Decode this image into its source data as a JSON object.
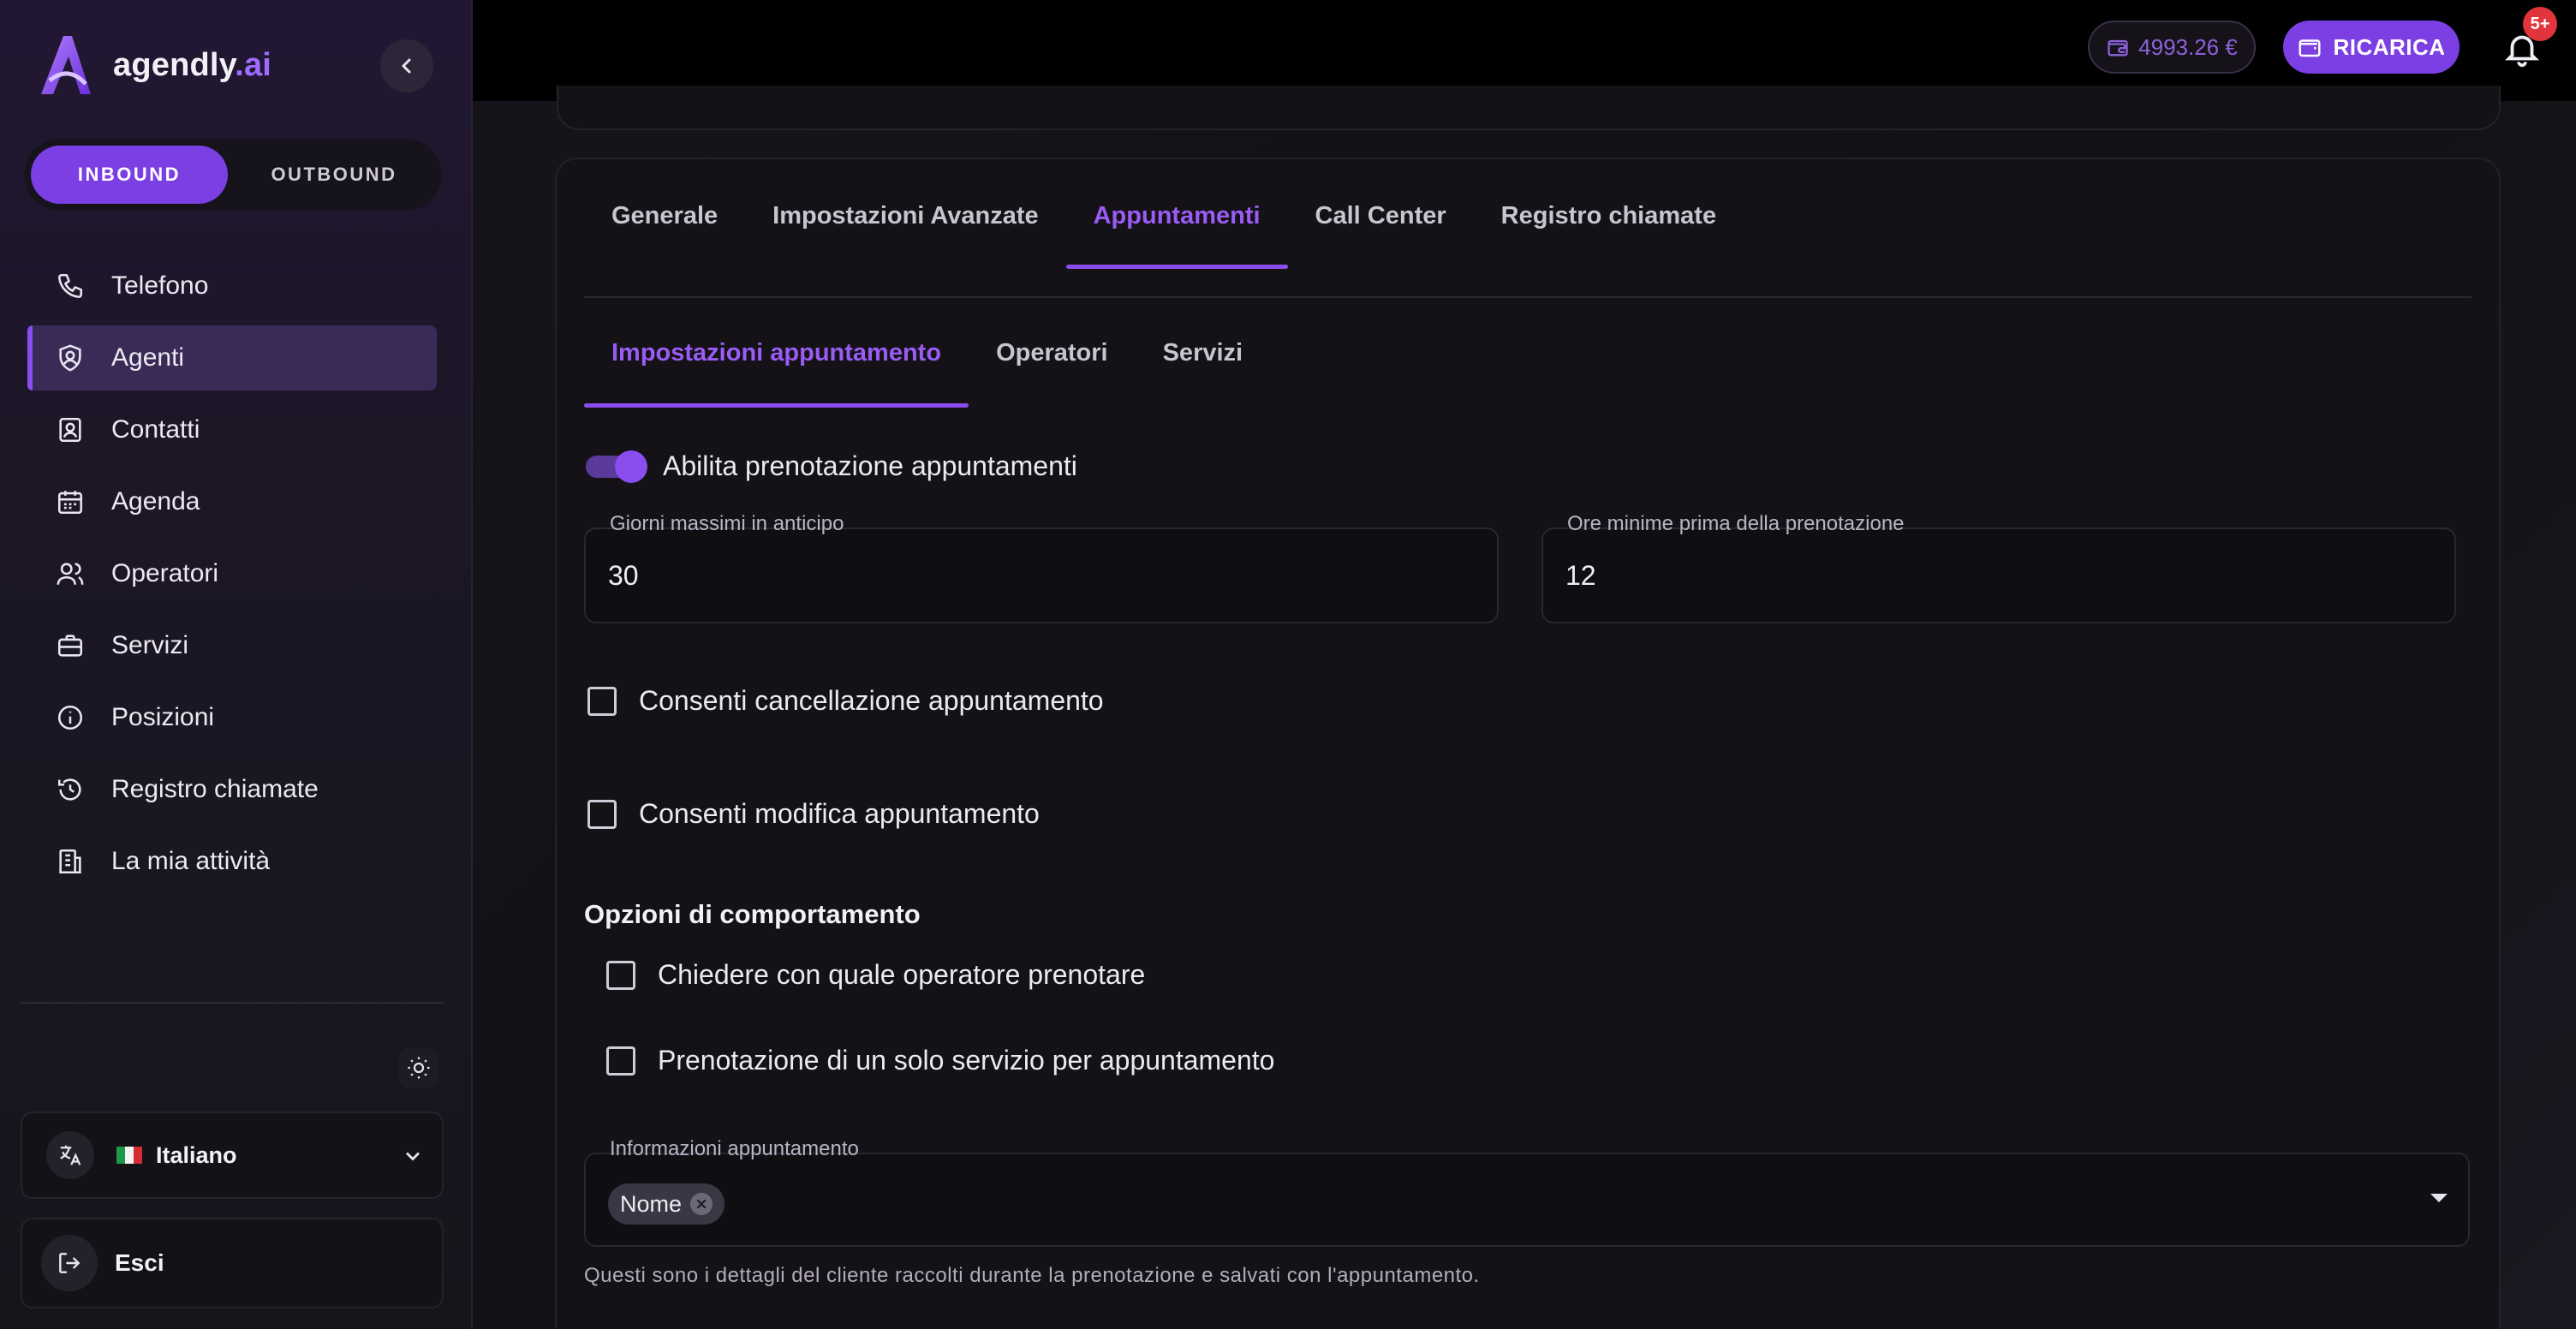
{
  "brand": {
    "name": "agendly",
    "suffix": ".ai"
  },
  "sidebar": {
    "mode_toggle": {
      "inbound": "INBOUND",
      "outbound": "OUTBOUND",
      "active": "INBOUND"
    },
    "items": [
      {
        "label": "Telefono",
        "icon": "phone-icon"
      },
      {
        "label": "Agenti",
        "icon": "shield-user-icon",
        "active": true
      },
      {
        "label": "Contatti",
        "icon": "contact-card-icon"
      },
      {
        "label": "Agenda",
        "icon": "calendar-icon"
      },
      {
        "label": "Operatori",
        "icon": "users-icon"
      },
      {
        "label": "Servizi",
        "icon": "briefcase-icon"
      },
      {
        "label": "Posizioni",
        "icon": "info-icon"
      },
      {
        "label": "Registro chiamate",
        "icon": "history-icon"
      },
      {
        "label": "La mia attività",
        "icon": "building-icon"
      }
    ],
    "language": {
      "label": "Italiano",
      "flag": "it"
    },
    "logout": "Esci"
  },
  "topbar": {
    "balance": "4993.26 €",
    "recharge": "RICARICA",
    "notifications_badge": "5+"
  },
  "tabs": [
    "Generale",
    "Impostazioni Avanzate",
    "Appuntamenti",
    "Call Center",
    "Registro chiamate"
  ],
  "active_tab": "Appuntamenti",
  "subtabs": [
    "Impostazioni appuntamento",
    "Operatori",
    "Servizi"
  ],
  "active_subtab": "Impostazioni appuntamento",
  "form": {
    "enable_booking": {
      "label": "Abilita prenotazione appuntamenti",
      "checked": true
    },
    "max_days": {
      "label": "Giorni massimi in anticipo",
      "value": "30"
    },
    "min_hours": {
      "label": "Ore minime prima della prenotazione",
      "value": "12"
    },
    "allow_cancel": {
      "label": "Consenti cancellazione appuntamento",
      "checked": false
    },
    "allow_edit": {
      "label": "Consenti modifica appuntamento",
      "checked": false
    },
    "behavior_title": "Opzioni di comportamento",
    "ask_operator": {
      "label": "Chiedere con quale operatore prenotare",
      "checked": false
    },
    "single_service": {
      "label": "Prenotazione di un solo servizio per appuntamento",
      "checked": false
    },
    "info": {
      "label": "Informazioni appuntamento",
      "chips": [
        "Nome"
      ],
      "helper": "Questi sono i dettagli del cliente raccolti durante la prenotazione e salvati con l'appuntamento."
    }
  },
  "colors": {
    "accent": "#7b3fe4",
    "accent_text": "#9a5cf5",
    "badge": "#e0353c"
  }
}
